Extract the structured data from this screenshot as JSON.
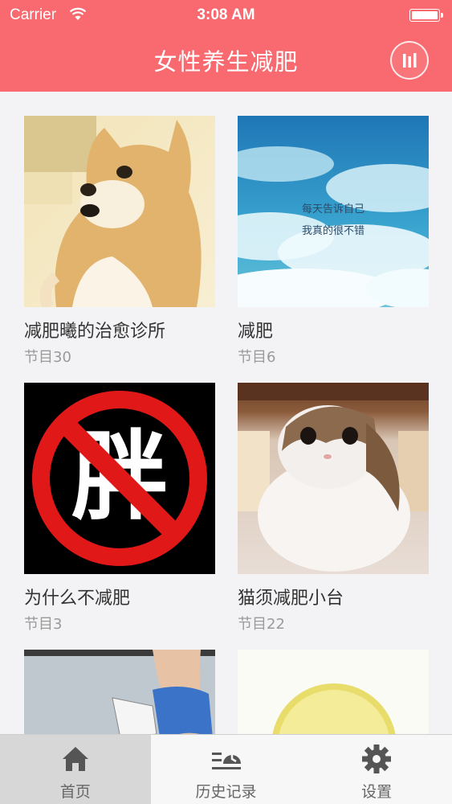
{
  "status_bar": {
    "carrier": "Carrier",
    "time": "3:08 AM"
  },
  "nav": {
    "title": "女性养生减肥",
    "right_icon": "stats-bars-icon"
  },
  "colors": {
    "brand": "#f86a6f",
    "active_tab_bg": "#d7d7d7"
  },
  "items": [
    {
      "title": "减肥曦的治愈诊所",
      "count": "节目30",
      "image": "shiba-dog-photo"
    },
    {
      "title": "减肥",
      "count": "节目6",
      "image": "cloud-sky-photo",
      "image_text": [
        "每天告诉自己",
        "我真的很不错"
      ]
    },
    {
      "title": "为什么不减肥",
      "count": "节目3",
      "image": "no-fat-sign",
      "image_text": [
        "胖"
      ]
    },
    {
      "title": "猫须减肥小台",
      "count": "节目22",
      "image": "cat-photo"
    },
    {
      "title": "",
      "count": "",
      "image": "waist-photo"
    },
    {
      "title": "",
      "count": "",
      "image": "lemon-photo"
    }
  ],
  "tabbar": {
    "tabs": [
      {
        "label": "首页",
        "icon": "home-icon",
        "active": true
      },
      {
        "label": "历史记录",
        "icon": "history-icon",
        "active": false
      },
      {
        "label": "设置",
        "icon": "gear-icon",
        "active": false
      }
    ]
  }
}
